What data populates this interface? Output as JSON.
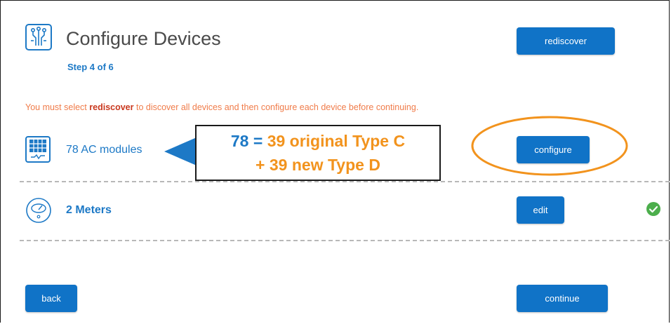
{
  "header": {
    "title": "Configure Devices",
    "step": "Step 4 of 6",
    "rediscover_label": "rediscover"
  },
  "warning": {
    "prefix": "You must select ",
    "keyword": "rediscover",
    "suffix": " to discover all devices and then configure each device before continuing."
  },
  "devices": [
    {
      "label": "78 AC modules",
      "icon": "solar-panel-icon",
      "action_label": "configure"
    },
    {
      "label": "2 Meters",
      "icon": "meter-gauge-icon",
      "action_label": "edit",
      "status": "check-icon"
    }
  ],
  "annotation": {
    "line1_prefix": "78 = ",
    "line1_rest": "39 original Type C",
    "line2": "+ 39 new Type D"
  },
  "footer": {
    "back_label": "back",
    "continue_label": "continue"
  },
  "colors": {
    "brand_blue": "#1073c7",
    "warning": "#f07c4a",
    "annotation_orange": "#f2931d",
    "success_green": "#4cae4c"
  }
}
